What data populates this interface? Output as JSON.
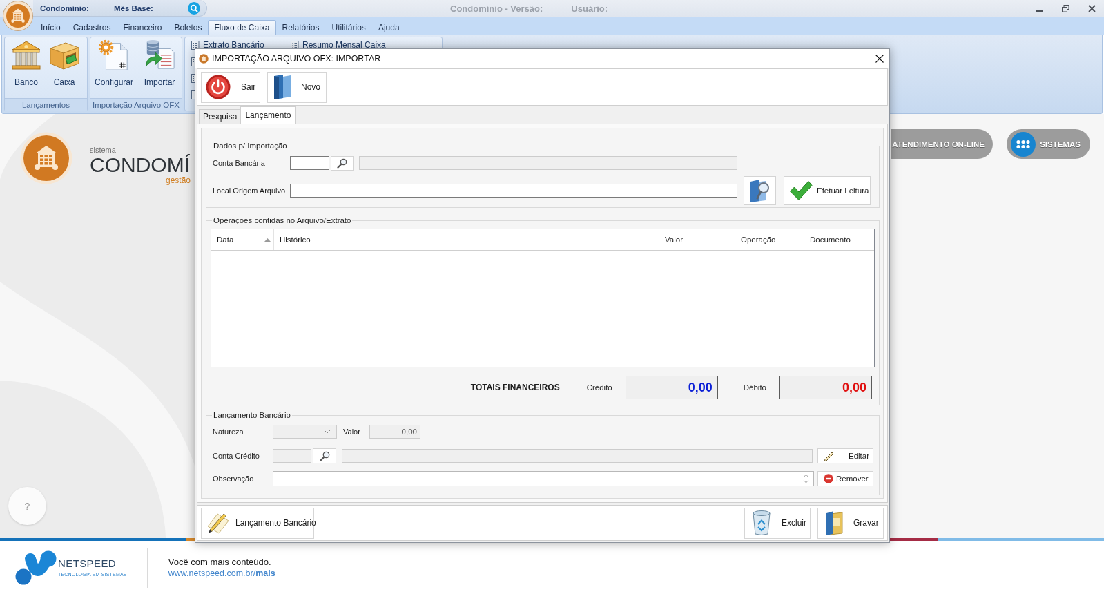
{
  "title_bar": {
    "fields": [
      "Condomínio:",
      "Mês Base:"
    ],
    "info": [
      "Condomínio - Versão:",
      "Usuário:"
    ]
  },
  "menu": [
    {
      "label": "Início",
      "selected": false
    },
    {
      "label": "Cadastros",
      "selected": false
    },
    {
      "label": "Financeiro",
      "selected": false
    },
    {
      "label": "Boletos",
      "selected": false
    },
    {
      "label": "Fluxo de Caixa",
      "selected": true
    },
    {
      "label": "Relatórios",
      "selected": false
    },
    {
      "label": "Utilitários",
      "selected": false
    },
    {
      "label": "Ajuda",
      "selected": false
    }
  ],
  "ribbon": {
    "groups": [
      {
        "title": "Lançamentos",
        "buttons": [
          "Banco",
          "Caixa"
        ]
      },
      {
        "title": "Importação Arquivo OFX",
        "buttons": [
          "Configurar",
          "Importar"
        ]
      }
    ],
    "reports": [
      "Extrato Bancário",
      "Resumo Mensal Caixa"
    ]
  },
  "home": {
    "caption": "sistema",
    "brand": "CONDOMÍ",
    "tagline": "gestão",
    "links": [
      "ATENDIMENTO ON-LINE",
      "SISTEMAS"
    ],
    "help": "?"
  },
  "footer": {
    "company": "NETSPEED",
    "company_tagline": "TECNOLOGIA EM SISTEMAS",
    "message": "Você com mais conteúdo.",
    "link": "www.netspeed.com.br/**mais**"
  },
  "dialog": {
    "title": "IMPORTAÇÃO ARQUIVO OFX: IMPORTAR",
    "toolbar": [
      "Sair",
      "Novo"
    ],
    "tabs": [
      {
        "label": "Pesquisa",
        "selected": false
      },
      {
        "label": "Lançamento",
        "selected": true
      }
    ],
    "import_data": {
      "legend": "Dados p/ Importação",
      "bank_account": {
        "label": "Conta Bancária",
        "code_disabled": false,
        "name_disabled": true
      },
      "source_file": {
        "label": "Local Origem Arquivo",
        "disabled": false
      },
      "read_button": "Efetuar Leitura"
    },
    "operations": {
      "legend": "Operações contidas no Arquivo/Extrato",
      "columns": [
        {
          "label": "Data",
          "sorted": true
        },
        {
          "label": "Histórico",
          "sorted": false
        },
        {
          "label": "Valor",
          "sorted": false
        },
        {
          "label": "Operação",
          "sorted": false
        },
        {
          "label": "Documento",
          "sorted": false
        }
      ],
      "totals_label": "TOTAIS FINANCEIROS",
      "totals": [
        {
          "kind": "credit",
          "label": "Crédito",
          "value": "0,00"
        },
        {
          "kind": "debit",
          "label": "Débito",
          "value": "0,00"
        }
      ]
    },
    "entry": {
      "legend": "Lançamento Bancário",
      "nature": {
        "label": "Natureza",
        "disabled": true
      },
      "amount": {
        "label": "Valor",
        "value": "0,00",
        "disabled": true
      },
      "credit_account": {
        "label": "Conta Crédito",
        "disabled": true
      },
      "note": {
        "label": "Observação",
        "disabled": false
      },
      "buttons": [
        "Editar",
        "Remover"
      ]
    },
    "actions": [
      "Lançamento Bancário",
      "Excluir",
      "Gravar"
    ]
  }
}
